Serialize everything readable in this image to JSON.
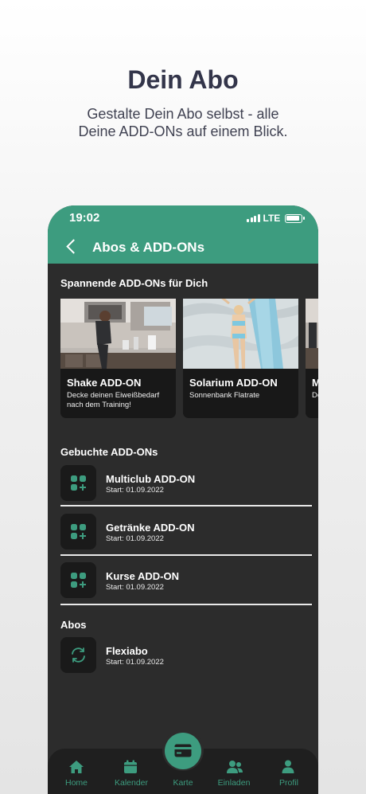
{
  "promo": {
    "headline": "Dein Abo",
    "subline_1": "Gestalte Dein Abo selbst - alle",
    "subline_2": "Deine ADD-ONs auf einem Blick."
  },
  "status_bar": {
    "time": "19:02",
    "network": "LTE"
  },
  "header": {
    "title": "Abos & ADD-ONs"
  },
  "addon_section": {
    "title": "Spannende ADD-ONs für Dich",
    "cards": [
      {
        "title": "Shake ADD-ON",
        "description": "Decke deinen Eiweißbedarf nach dem Training!"
      },
      {
        "title": "Solarium ADD-ON",
        "description": "Sonnenbank Flatrate"
      },
      {
        "title": "M",
        "description": "De na"
      }
    ]
  },
  "booked_section": {
    "title": "Gebuchte ADD-ONs",
    "items": [
      {
        "title": "Multiclub ADD-ON",
        "subtitle": "Start: 01.09.2022",
        "icon": "addon-grid-icon"
      },
      {
        "title": "Getränke ADD-ON",
        "subtitle": "Start: 01.09.2022",
        "icon": "addon-grid-icon"
      },
      {
        "title": "Kurse ADD-ON",
        "subtitle": "Start: 01.09.2022",
        "icon": "addon-grid-icon"
      }
    ]
  },
  "abos_section": {
    "title": "Abos",
    "items": [
      {
        "title": "Flexiabo",
        "subtitle": "Start: 01.09.2022",
        "icon": "renew-arrows-icon"
      }
    ]
  },
  "tabbar": {
    "tabs": [
      {
        "label": "Home",
        "icon": "home-icon"
      },
      {
        "label": "Kalender",
        "icon": "calendar-icon"
      },
      {
        "label": "Karte",
        "icon": "card-icon"
      },
      {
        "label": "Einladen",
        "icon": "invite-users-icon"
      },
      {
        "label": "Profil",
        "icon": "profile-icon"
      }
    ]
  },
  "colors": {
    "accent": "#3d9c7f",
    "screen_background": "#2c2c2c",
    "tile_background": "#1a1a1a",
    "headline": "#33354a"
  }
}
